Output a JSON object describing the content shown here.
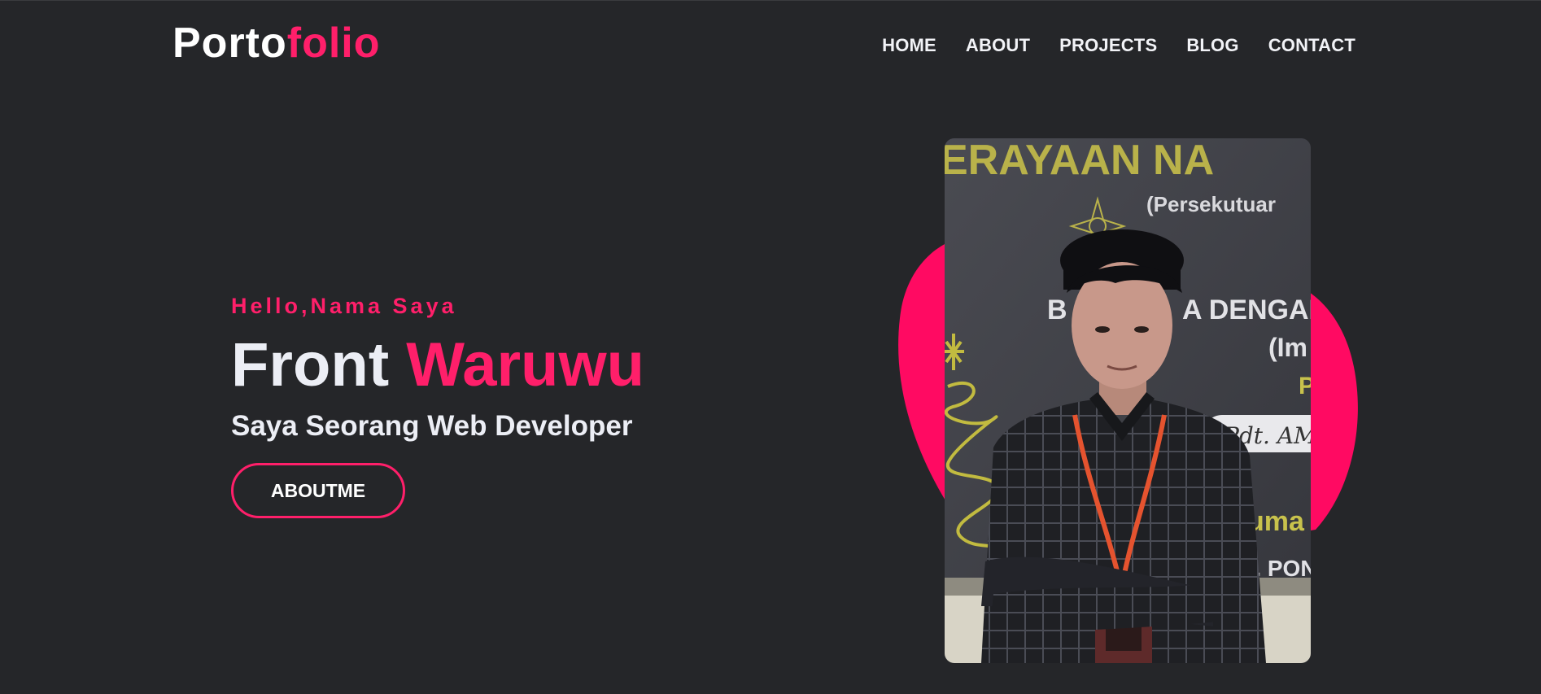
{
  "header": {
    "logo": {
      "part1": "Porto",
      "part2": "folio"
    },
    "nav": [
      "HOME",
      "ABOUT",
      "PROJECTS",
      "BLOG",
      "CONTACT"
    ]
  },
  "hero": {
    "greeting": "Hello,Nama Saya",
    "name_first": "Front",
    "name_last": "Waruwu",
    "role": "Saya Seorang Web Developer",
    "button_label": "ABOUTME"
  },
  "photo": {
    "banner_text": [
      "ERAYAAN NA",
      "(Persekutuar",
      "B",
      "A DENGAI",
      "(Im",
      "P",
      "uma",
      "M. PON"
    ],
    "name_card": "Pdt. AM"
  },
  "colors": {
    "background": "#252629",
    "accent": "#ff1f6a",
    "text": "#eceef5"
  }
}
